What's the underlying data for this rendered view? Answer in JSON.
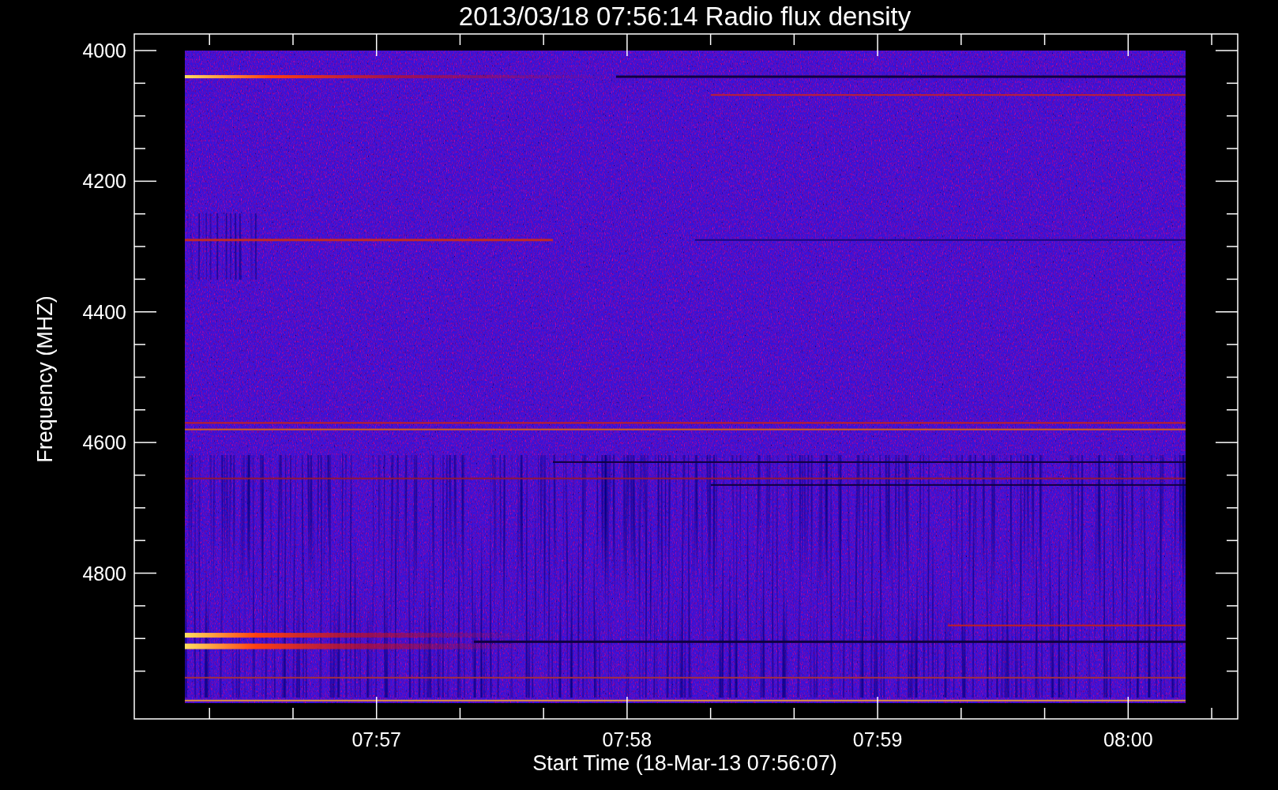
{
  "plot": {
    "title": "2013/03/18 07:56:14 Radio flux density",
    "ylabel": "Frequency (MHZ)",
    "xlabel": "Start Time (18-Mar-13 07:56:07)",
    "yticks": [
      "4000",
      "4200",
      "4400",
      "4600",
      "4800"
    ],
    "xticks": [
      "07:57",
      "07:58",
      "07:59",
      "08:00"
    ]
  }
}
